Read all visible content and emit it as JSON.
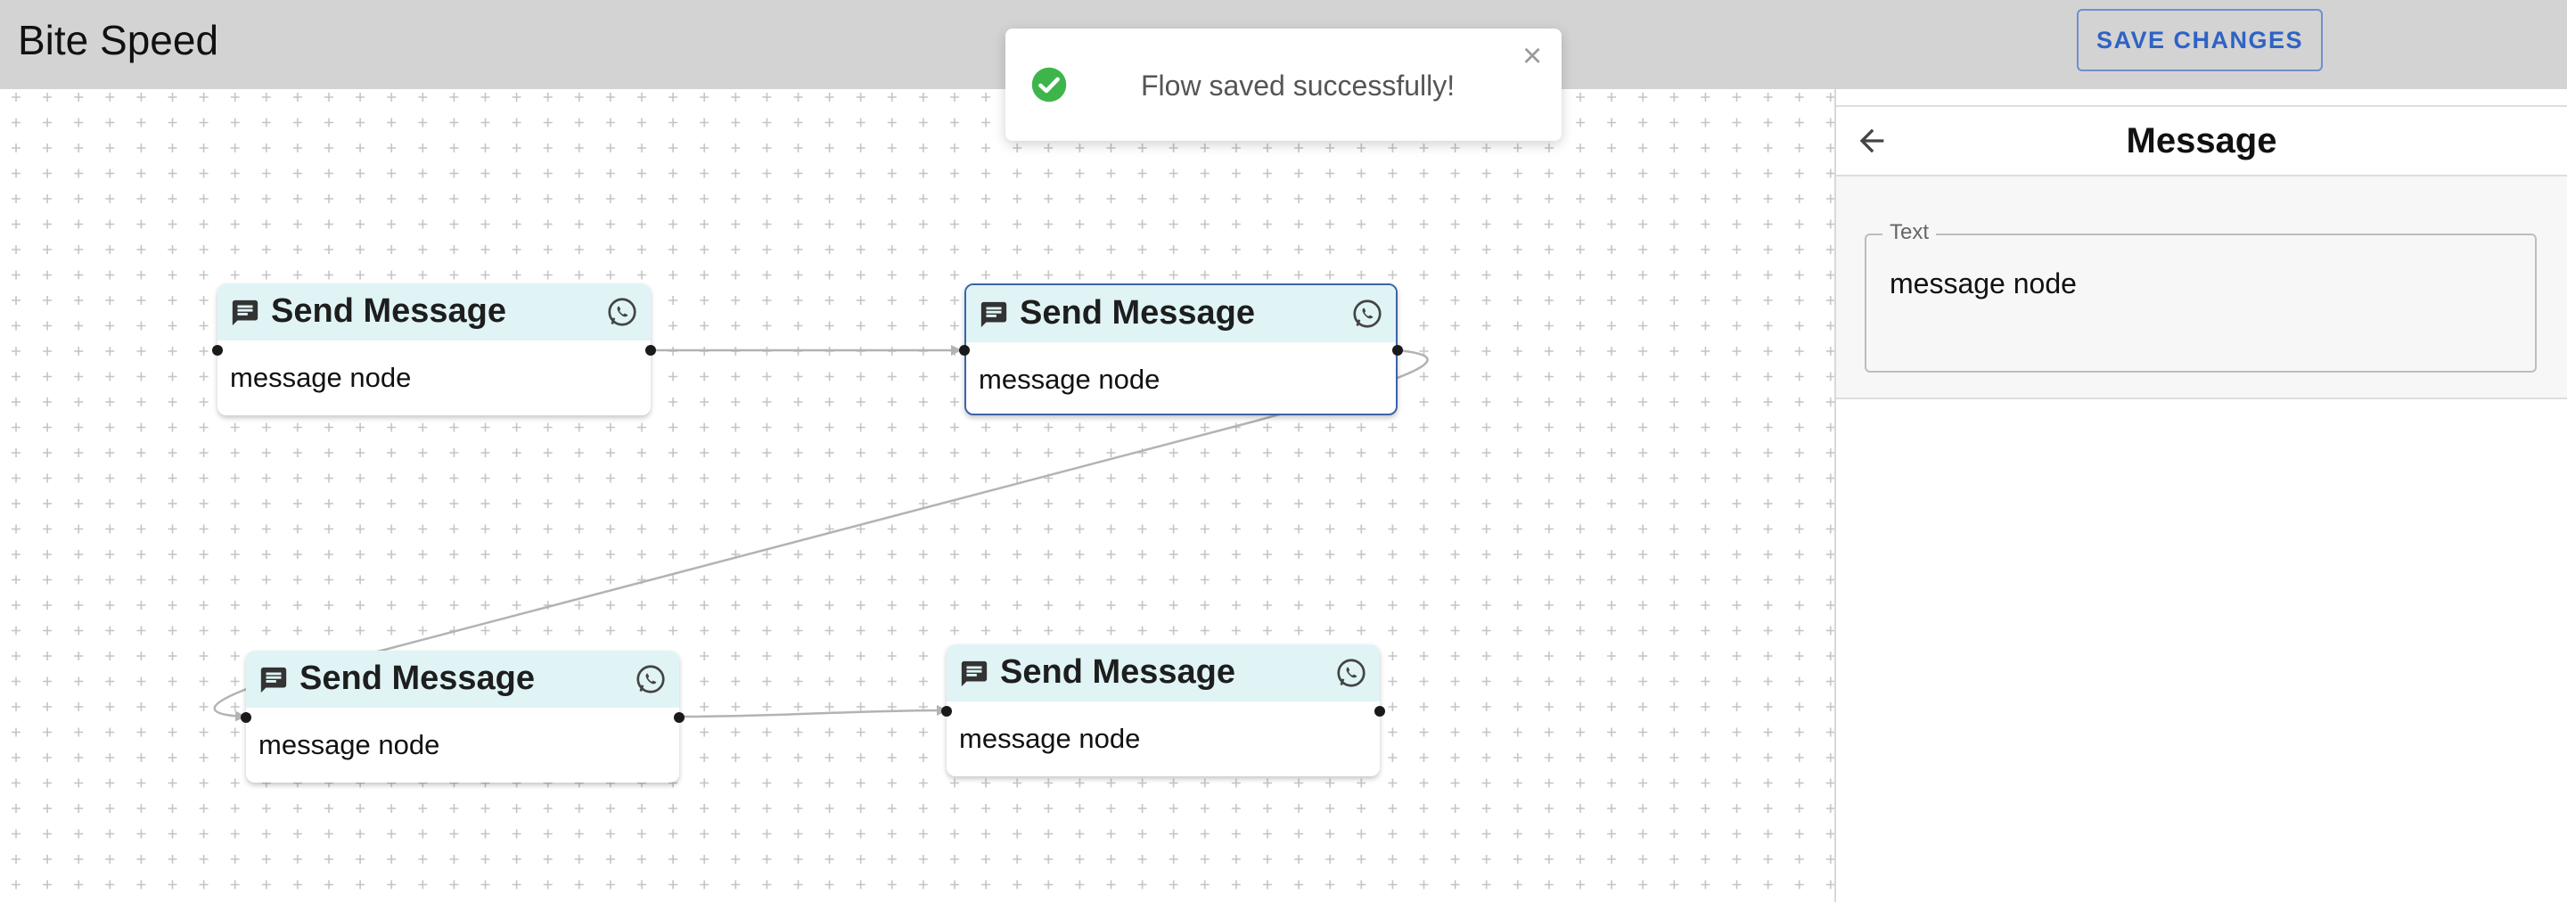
{
  "header": {
    "app_title": "Bite Speed",
    "save_label": "SAVE CHANGES"
  },
  "toast": {
    "message": "Flow saved successfully!",
    "close_glyph": "×",
    "icon": "check-circle-icon",
    "accent": "#3db54a"
  },
  "canvas": {
    "nodes": [
      {
        "title": "Send Message",
        "text": "message node",
        "selected": false
      },
      {
        "title": "Send Message",
        "text": "message node",
        "selected": true
      },
      {
        "title": "Send Message",
        "text": "message node",
        "selected": false
      },
      {
        "title": "Send Message",
        "text": "message node",
        "selected": false
      }
    ],
    "header_color": "#e0f4f6",
    "selected_border_color": "#3c64a8"
  },
  "panel": {
    "title": "Message",
    "back_icon": "arrow-left-icon",
    "text_field": {
      "label": "Text",
      "value": "message node"
    }
  }
}
